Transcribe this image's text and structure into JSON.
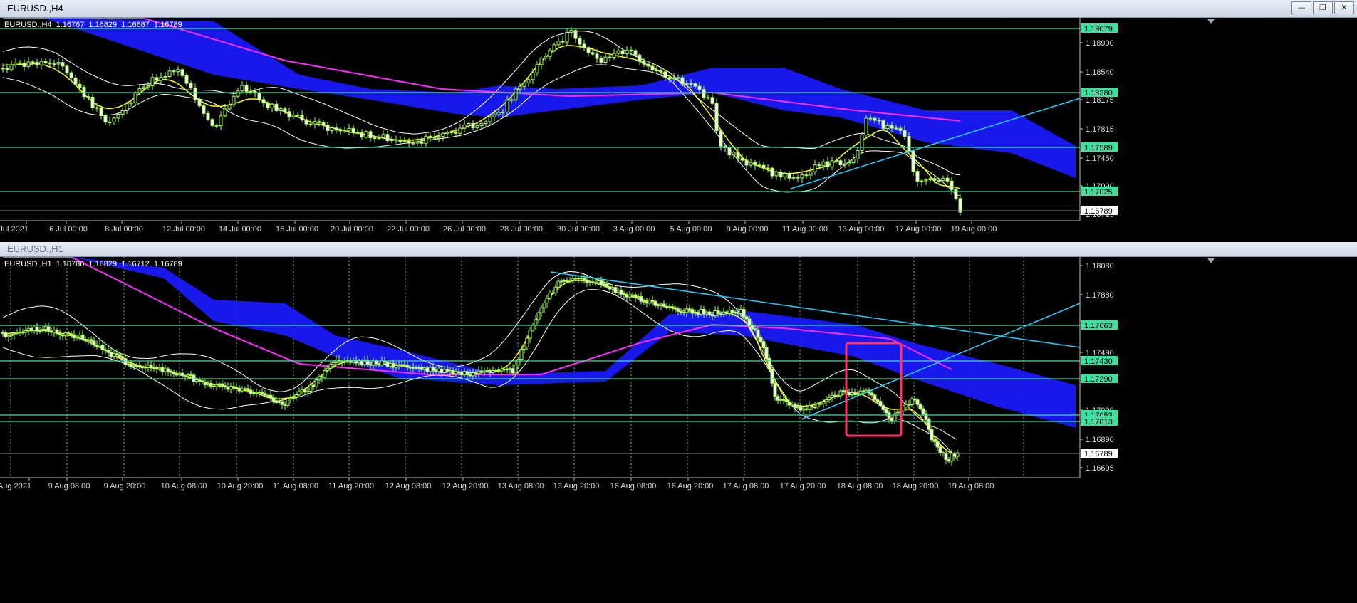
{
  "window1": {
    "title": "EURUSD.,H4",
    "symbol": "EURUSD.,H4",
    "ohlc": [
      "1.16767",
      "1.16829",
      "1.16687",
      "1.16789"
    ],
    "buttons": {
      "minimize": "—",
      "restore": "❐",
      "close": "✕"
    },
    "price_scale": [
      "1.18900",
      "1.18540",
      "1.18175",
      "1.17815",
      "1.17450",
      "1.17090",
      "1.16725"
    ],
    "level_labels": [
      "1.19079",
      "1.18280",
      "1.17589",
      "1.17025"
    ],
    "current_price": "1.16789",
    "time_labels": [
      "Jul 2021",
      "6 Jul 00:00",
      "8 Jul 00:00",
      "12 Jul 00:00",
      "14 Jul 00:00",
      "16 Jul 00:00",
      "20 Jul 00:00",
      "22 Jul 00:00",
      "26 Jul 00:00",
      "28 Jul 00:00",
      "30 Jul 00:00",
      "3 Aug 00:00",
      "5 Aug 00:00",
      "9 Aug 00:00",
      "11 Aug 00:00",
      "13 Aug 00:00",
      "17 Aug 00:00",
      "19 Aug 00:00"
    ]
  },
  "window2": {
    "title": "EURUSD.,H1",
    "symbol": "EURUSD.,H1",
    "ohlc": [
      "1.16786",
      "1.16829",
      "1.16712",
      "1.16789"
    ],
    "price_scale": [
      "1.18080",
      "1.17880",
      "1.17490",
      "1.17090",
      "1.16890",
      "1.16695"
    ],
    "level_labels": [
      "1.17663",
      "1.17430",
      "1.17290",
      "1.17053",
      "1.17013"
    ],
    "current_price": "1.16789",
    "time_labels": [
      "Aug 2021",
      "9 Aug 08:00",
      "9 Aug 20:00",
      "10 Aug 08:00",
      "10 Aug 20:00",
      "11 Aug 08:00",
      "11 Aug 20:00",
      "12 Aug 08:00",
      "12 Aug 20:00",
      "13 Aug 08:00",
      "13 Aug 20:00",
      "16 Aug 08:00",
      "16 Aug 20:00",
      "17 Aug 08:00",
      "17 Aug 20:00",
      "18 Aug 08:00",
      "18 Aug 20:00",
      "19 Aug 08:00"
    ]
  },
  "colors": {
    "background": "#000000",
    "level_line": "#3ee0a0",
    "trendline": "#20d0ff",
    "cloud": "#1a1aff",
    "ma_fast": "#ffff00",
    "ma_slow": "#ff2aff",
    "bands": "#ffffff",
    "candle": "#a6ff5a",
    "highlight_box": "#ff3366"
  }
}
